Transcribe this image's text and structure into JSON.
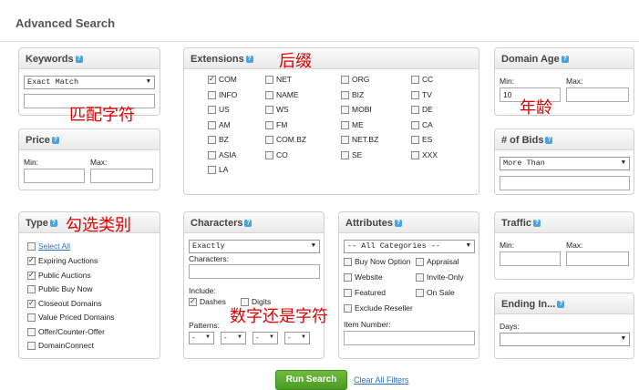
{
  "page_title": "Advanced Search",
  "keywords": {
    "title": "Keywords",
    "match_select": "Exact Match",
    "input_value": ""
  },
  "price": {
    "title": "Price",
    "min_label": "Min:",
    "max_label": "Max:"
  },
  "extensions": {
    "title": "Extensions",
    "items": [
      {
        "label": "COM",
        "checked": true
      },
      {
        "label": "NET",
        "checked": false
      },
      {
        "label": "ORG",
        "checked": false
      },
      {
        "label": "CC",
        "checked": false
      },
      {
        "label": "INFO",
        "checked": false
      },
      {
        "label": "NAME",
        "checked": false
      },
      {
        "label": "BIZ",
        "checked": false
      },
      {
        "label": "TV",
        "checked": false
      },
      {
        "label": "US",
        "checked": false
      },
      {
        "label": "WS",
        "checked": false
      },
      {
        "label": "MOBI",
        "checked": false
      },
      {
        "label": "DE",
        "checked": false
      },
      {
        "label": "AM",
        "checked": false
      },
      {
        "label": "FM",
        "checked": false
      },
      {
        "label": "ME",
        "checked": false
      },
      {
        "label": "CA",
        "checked": false
      },
      {
        "label": "BZ",
        "checked": false
      },
      {
        "label": "COM.BZ",
        "checked": false
      },
      {
        "label": "NET.BZ",
        "checked": false
      },
      {
        "label": "ES",
        "checked": false
      },
      {
        "label": "ASIA",
        "checked": false
      },
      {
        "label": "CO",
        "checked": false
      },
      {
        "label": "SE",
        "checked": false
      },
      {
        "label": "XXX",
        "checked": false
      },
      {
        "label": "LA",
        "checked": false
      }
    ]
  },
  "domain_age": {
    "title": "Domain Age",
    "min_label": "Min:",
    "max_label": "Max:",
    "min_value": "10"
  },
  "bids": {
    "title": "# of Bids",
    "select_value": "More Than"
  },
  "type": {
    "title": "Type",
    "select_all": "Select All",
    "items": [
      {
        "label": "Expiring Auctions",
        "checked": true
      },
      {
        "label": "Public Auctions",
        "checked": true
      },
      {
        "label": "Public Buy Now",
        "checked": false
      },
      {
        "label": "Closeout Domains",
        "checked": true
      },
      {
        "label": "Value Priced Domains",
        "checked": false
      },
      {
        "label": "Offer/Counter-Offer",
        "checked": false
      },
      {
        "label": "DomainConnect",
        "checked": false
      }
    ]
  },
  "characters": {
    "title": "Characters",
    "select_value": "Exactly",
    "characters_label": "Characters:",
    "include_label": "Include:",
    "dashes_label": "Dashes",
    "digits_label": "Digits",
    "patterns_label": "Patterns:",
    "pattern_value": "-"
  },
  "attributes": {
    "title": "Attributes",
    "select_value": "-- All Categories --",
    "items": [
      {
        "label": "Buy Now Option",
        "checked": false
      },
      {
        "label": "Appraisal",
        "checked": false
      },
      {
        "label": "Website",
        "checked": false
      },
      {
        "label": "Invite-Only",
        "checked": false
      },
      {
        "label": "Featured",
        "checked": false
      },
      {
        "label": "On Sale",
        "checked": false
      },
      {
        "label": "Exclude Reseller",
        "checked": false
      }
    ],
    "item_number_label": "Item Number:"
  },
  "traffic": {
    "title": "Traffic",
    "min_label": "Min:",
    "max_label": "Max:"
  },
  "ending": {
    "title": "Ending In...",
    "days_label": "Days:"
  },
  "annotations": {
    "extensions": "后缀",
    "keywords": "匹配字符",
    "age": "年龄",
    "type": "勾选类别",
    "characters": "数字还是字符"
  },
  "footer": {
    "run_button": "Run Search",
    "clear_link": "Clear All Filters"
  },
  "help_icon": "?",
  "colors": {
    "accent_blue": "#4aa3df",
    "link_blue": "#2a6fc4",
    "button_green": "#4a9c26",
    "annotation_red": "#e00000"
  }
}
